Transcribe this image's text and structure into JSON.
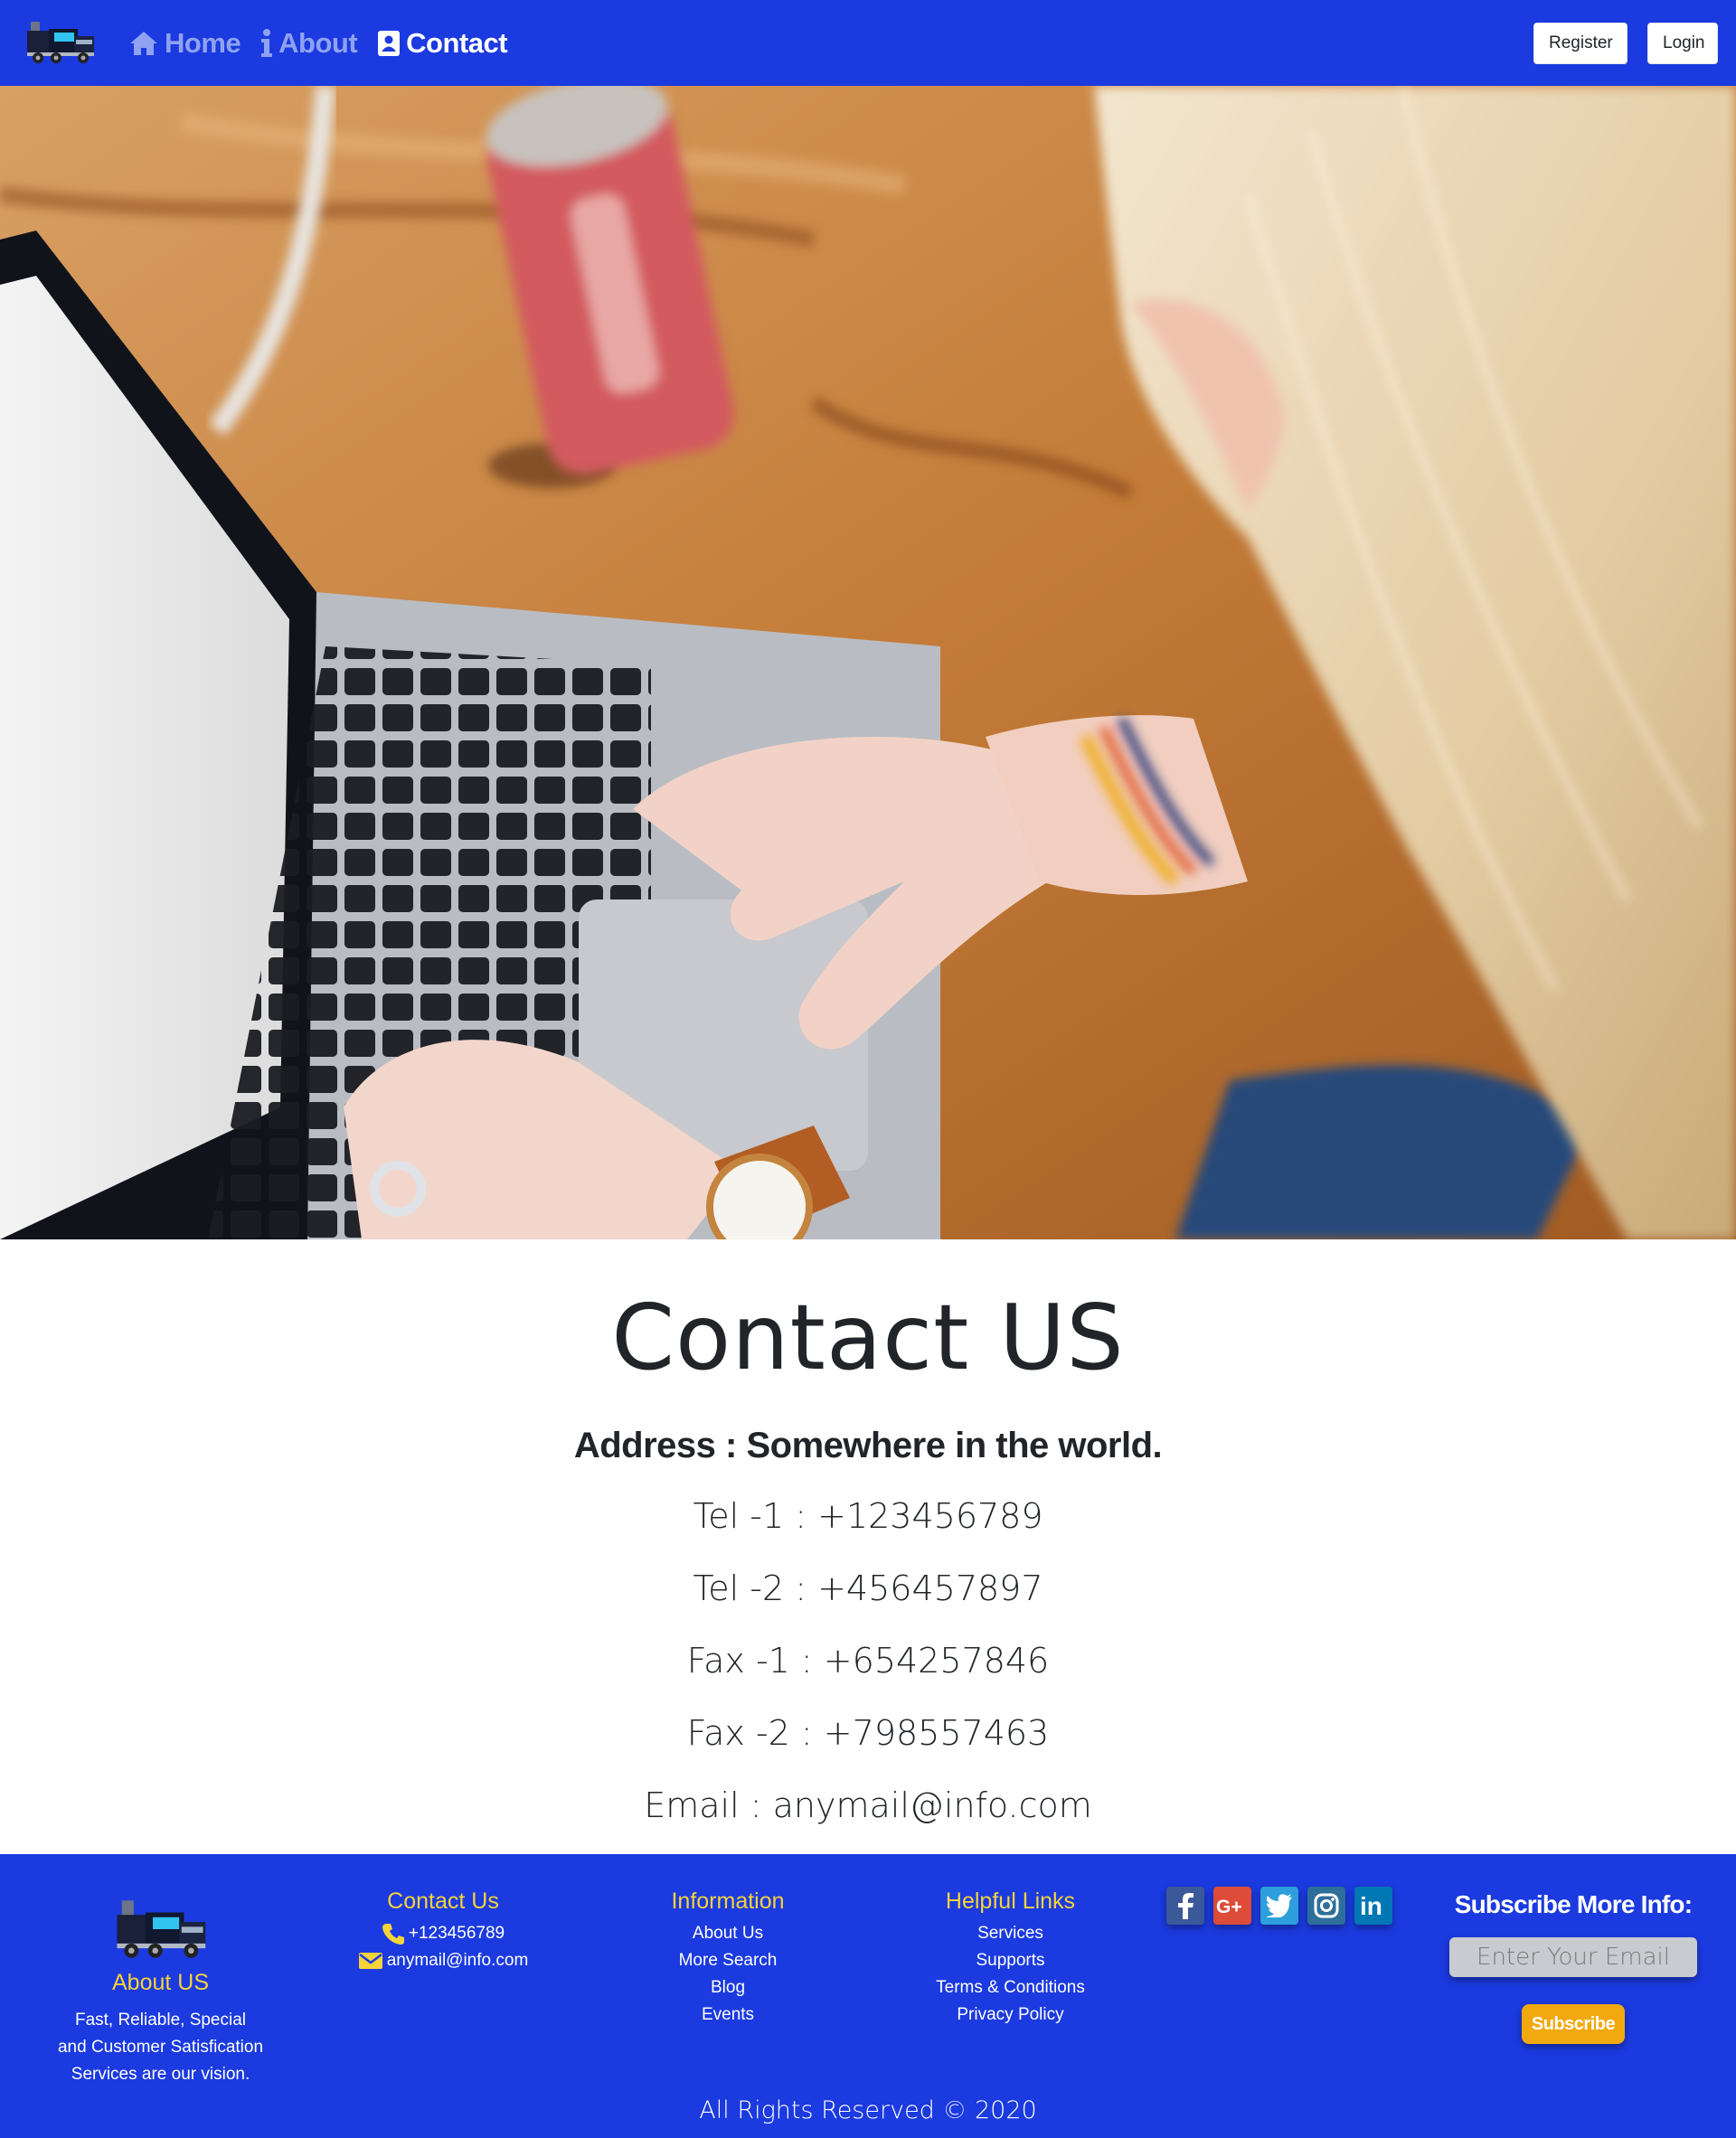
{
  "nav": {
    "logo_icon": "truck-logo-icon",
    "links": [
      {
        "label": "Home",
        "icon": "home-icon"
      },
      {
        "label": "About",
        "icon": "info-icon"
      },
      {
        "label": "Contact",
        "icon": "contact-card-icon",
        "active": true
      }
    ],
    "register_label": "Register",
    "login_label": "Login",
    "colors": {
      "bar": "#1b3adf",
      "inactive_link": "#8fa2f2",
      "active_link": "#ffffff"
    }
  },
  "hero": {
    "image": "photo of a person typing on a laptop at a wooden desk"
  },
  "contact": {
    "title": "Contact US",
    "address": "Address : Somewhere in the world.",
    "tel1": "Tel -1 : +123456789",
    "tel2": "Tel -2 : +456457897",
    "fax1": "Fax -1 : +654257846",
    "fax2": "Fax -2 : +798557463",
    "email": "Email : anymail@info.com"
  },
  "footer": {
    "about": {
      "heading": "About US",
      "line1": "Fast, Reliable, Special",
      "line2": "and Customer Satisfication",
      "line3": "Services are our vision."
    },
    "contact": {
      "heading": "Contact Us",
      "phone": "+123456789",
      "email": "anymail@info.com"
    },
    "information": {
      "heading": "Information",
      "links": [
        "About Us",
        "More Search",
        "Blog",
        "Events"
      ]
    },
    "helpful": {
      "heading": "Helpful Links",
      "links": [
        "Services",
        "Supports",
        "Terms & Conditions",
        "Privacy Policy"
      ]
    },
    "socials": [
      "facebook-icon",
      "google-plus-icon",
      "twitter-icon",
      "instagram-icon",
      "linkedin-icon"
    ],
    "subscribe": {
      "title": "Subscribe More Info:",
      "placeholder": "Enter Your Email",
      "button": "Subscribe"
    },
    "copyright": "All Rights Reserved © 2020",
    "colors": {
      "background": "#1b3adf",
      "heading": "#f5d33b",
      "button": "#f2a90f"
    }
  }
}
